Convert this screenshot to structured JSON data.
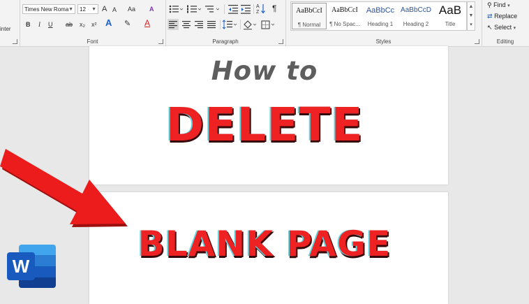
{
  "ribbon": {
    "clipboard": {
      "partial_label": "inter"
    },
    "font": {
      "label": "Font",
      "font_name": "Times New Roma",
      "font_size": "12",
      "buttons": {
        "grow": "A",
        "shrink": "A",
        "change_case": "Aa",
        "clear": "A",
        "bold": "B",
        "italic": "I",
        "underline": "U",
        "strike": "ab",
        "subscript": "x₂",
        "superscript": "x²",
        "effects": "A",
        "highlight": "✎",
        "font_color": "A"
      }
    },
    "paragraph": {
      "label": "Paragraph"
    },
    "styles": {
      "label": "Styles",
      "items": [
        {
          "sample": "AaBbCcI",
          "name": "¶ Normal"
        },
        {
          "sample": "AaBbCcI",
          "name": "¶ No Spac..."
        },
        {
          "sample": "AaBbCc",
          "name": "Heading 1"
        },
        {
          "sample": "AaBbCcD",
          "name": "Heading 2"
        },
        {
          "sample": "AaB",
          "name": "Title"
        }
      ]
    },
    "editing": {
      "label": "Editing",
      "find": "Find",
      "replace": "Replace",
      "select": "Select"
    }
  },
  "document": {
    "line1": "How to",
    "line2": "DELETE",
    "line3": "BLANK PAGE"
  },
  "colors": {
    "accent_red": "#ee2222",
    "word_blue": "#185abd",
    "ribbon_bg": "#f3f3f3"
  },
  "logo": {
    "letter": "W"
  }
}
